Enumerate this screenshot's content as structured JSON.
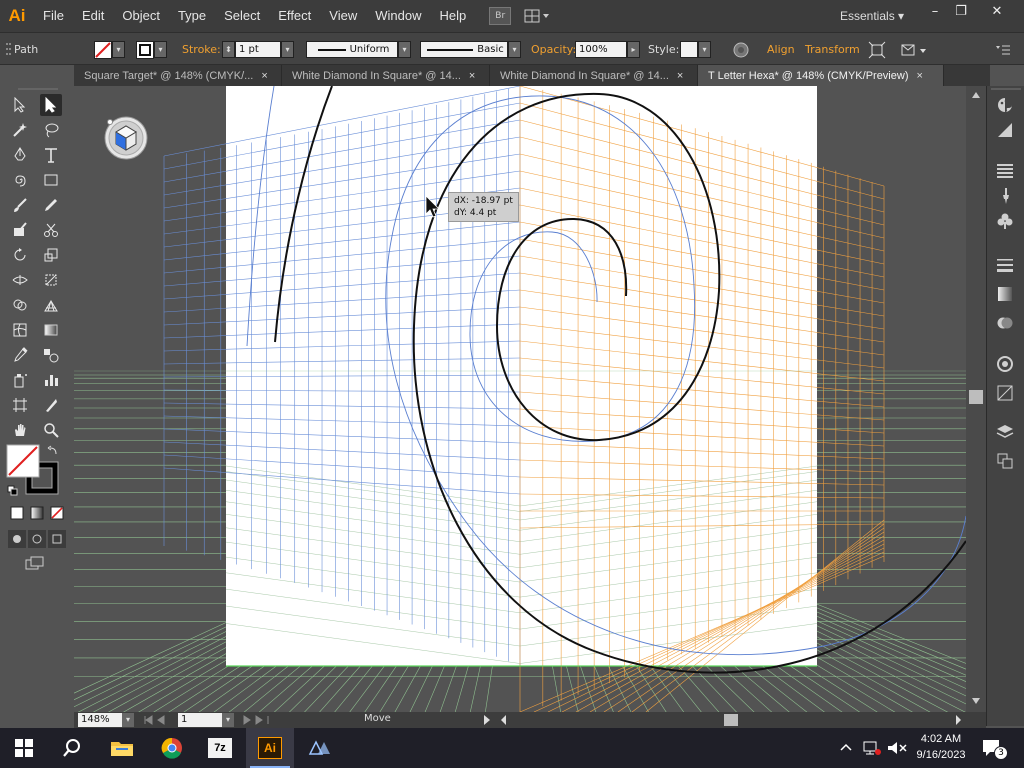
{
  "app": {
    "logo": "Ai",
    "menu": [
      "File",
      "Edit",
      "Object",
      "Type",
      "Select",
      "Effect",
      "View",
      "Window",
      "Help"
    ],
    "bridge_label": "Br",
    "workspace": "Essentials",
    "window_controls": {
      "minimize": "–",
      "restore": "❐",
      "close": "✕"
    }
  },
  "controlbar": {
    "selection_type": "Path",
    "stroke_label": "Stroke:",
    "stroke_weight": "1 pt",
    "profile": "Uniform",
    "brush": "Basic",
    "opacity_label": "Opacity:",
    "opacity_value": "100%",
    "style_label": "Style:",
    "align_label": "Align",
    "transform_label": "Transform"
  },
  "tabs": [
    {
      "label": "Square Target* @ 148% (CMYK/...",
      "close": "×"
    },
    {
      "label": "White Diamond In Square* @ 14...",
      "close": "×"
    },
    {
      "label": "White Diamond In Square* @ 14...",
      "close": "×"
    },
    {
      "label": "T Letter Hexa* @ 148% (CMYK/Preview)",
      "close": "×",
      "active": true
    }
  ],
  "canvas": {
    "tooltip_dx": "dX: -18.97 pt",
    "tooltip_dy": "dY: 4.4 pt"
  },
  "statusbar": {
    "zoom": "148%",
    "artboard": "1",
    "status": "Move"
  },
  "taskbar": {
    "apps": [
      "start-icon",
      "search-icon",
      "file-explorer-icon",
      "chrome-icon",
      "7zip-icon",
      "illustrator-icon",
      "app-icon"
    ],
    "label_7z": "7z",
    "label_ai": "Ai",
    "time": "4:02 AM",
    "date": "9/16/2023",
    "notification_count": "3"
  },
  "colors": {
    "grid_blue": "#6a8fd8",
    "grid_orange": "#f0a040",
    "grid_green": "#8fbf8f",
    "accent_orange": "#ff9a00"
  }
}
